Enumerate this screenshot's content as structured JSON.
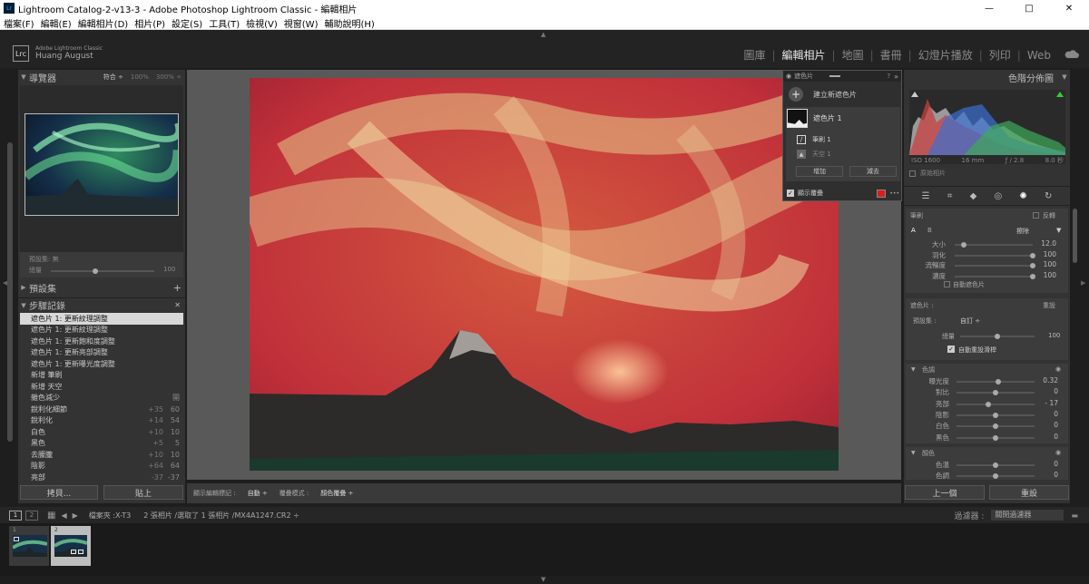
{
  "window": {
    "title": "Lightroom Catalog-2-v13-3 - Adobe Photoshop Lightroom Classic - 編輯相片",
    "minimize": "—",
    "maximize": "□",
    "close": "✕"
  },
  "menu": [
    "檔案(F)",
    "編輯(E)",
    "編輯相片(D)",
    "相片(P)",
    "設定(S)",
    "工具(T)",
    "檢視(V)",
    "視窗(W)",
    "輔助說明(H)"
  ],
  "identity": {
    "badge": "Lrc",
    "app": "Adobe Lightroom Classic",
    "user": "Huang August"
  },
  "modules": [
    {
      "label": "圖庫",
      "active": false
    },
    {
      "label": "編輯相片",
      "active": true
    },
    {
      "label": "地圖",
      "active": false
    },
    {
      "label": "書冊",
      "active": false
    },
    {
      "label": "幻燈片播放",
      "active": false
    },
    {
      "label": "列印",
      "active": false
    },
    {
      "label": "Web",
      "active": false
    }
  ],
  "navigator": {
    "title": "導覽器",
    "fit": "符合 ÷",
    "z1": "100%",
    "z2": "300% ÷"
  },
  "preset_amount": {
    "label": "預設集: 無",
    "amount_label": "總量",
    "amount_value": "100",
    "amount": 1.0
  },
  "presets": {
    "title": "預設集",
    "add": "+"
  },
  "history": {
    "title": "步驟記錄",
    "close": "✕",
    "items": [
      {
        "label": "遮色片 1: 更新紋理調整",
        "a": "",
        "b": "",
        "selected": true
      },
      {
        "label": "遮色片 1: 更新紋理調整",
        "a": "",
        "b": ""
      },
      {
        "label": "遮色片 1: 更新飽和度調整",
        "a": "",
        "b": ""
      },
      {
        "label": "遮色片 1: 更新亮部調整",
        "a": "",
        "b": ""
      },
      {
        "label": "遮色片 1: 更新曝光度調整",
        "a": "",
        "b": ""
      },
      {
        "label": "新增 筆刷",
        "a": "",
        "b": ""
      },
      {
        "label": "新增 天空",
        "a": "",
        "b": ""
      },
      {
        "label": "雜色減少",
        "a": "",
        "b": "開"
      },
      {
        "label": "銳利化細節",
        "a": "+35",
        "b": "60"
      },
      {
        "label": "銳利化",
        "a": "+14",
        "b": "54"
      },
      {
        "label": "白色",
        "a": "+10",
        "b": "10"
      },
      {
        "label": "黑色",
        "a": "+5",
        "b": "5"
      },
      {
        "label": "去朦朧",
        "a": "+10",
        "b": "10"
      },
      {
        "label": "陰影",
        "a": "+64",
        "b": "64"
      },
      {
        "label": "亮部",
        "a": "-37",
        "b": "-37"
      }
    ]
  },
  "left_buttons": {
    "copy": "拷貝...",
    "paste": "貼上"
  },
  "mask_panel": {
    "title": "遮色片",
    "help": "?",
    "expand": "»",
    "new_mask": "建立新遮色片",
    "mask_name": "遮色片 1",
    "component1": "筆刷 1",
    "component2": "天空 1",
    "add": "增加",
    "subtract": "減去",
    "overlay_label": "顯示覆疊",
    "more": "•••",
    "overlay_color": "#d81e1e"
  },
  "toolbar": {
    "show_label": "顯示編輯標記 :",
    "show_value": "自動 ÷",
    "overlay_label": "覆疊模式 :",
    "overlay_value": "顏色覆疊 ÷"
  },
  "histogram": {
    "title": "色階分佈圖",
    "iso": "ISO 1600",
    "focal": "16 mm",
    "aperture": "ƒ / 2.8",
    "shutter": "8.0 秒",
    "original": "原始相片"
  },
  "brush": {
    "title": "筆刷",
    "invert": "反轉",
    "a": "A",
    "b": "B",
    "erase": "擦除",
    "rows": [
      {
        "label": "大小",
        "value": "12.0",
        "pos": 0.12
      },
      {
        "label": "羽化",
        "value": "100",
        "pos": 1.0
      },
      {
        "label": "流暢度",
        "value": "100",
        "pos": 1.0
      },
      {
        "label": "濃度",
        "value": "100",
        "pos": 1.0
      }
    ],
    "automask": "自動遮色片"
  },
  "mask_settings": {
    "title": "遮色片 :",
    "reset": "重設",
    "preset_label": "預設集 :",
    "preset_value": "自訂 ÷",
    "amount_label": "總量",
    "amount_value": "100",
    "amount": 0.5,
    "auto_reset": "自動重設滑桿"
  },
  "tone": {
    "title": "色調",
    "rows": [
      {
        "label": "曝光度",
        "value": "0.32",
        "pos": 0.53
      },
      {
        "label": "對比",
        "value": "0",
        "pos": 0.5
      },
      {
        "label": "亮部",
        "value": "- 17",
        "pos": 0.41
      },
      {
        "label": "陰影",
        "value": "0",
        "pos": 0.5
      },
      {
        "label": "白色",
        "value": "0",
        "pos": 0.5
      },
      {
        "label": "黑色",
        "value": "0",
        "pos": 0.5
      }
    ]
  },
  "color": {
    "title": "顏色",
    "rows": [
      {
        "label": "色溫",
        "value": "0",
        "pos": 0.5
      },
      {
        "label": "色調",
        "value": "0",
        "pos": 0.5
      }
    ]
  },
  "right_buttons": {
    "prev": "上一個",
    "reset": "重設"
  },
  "filmstrip": {
    "view1": "1",
    "view2": "2",
    "folder": "檔案夾 :X-T3",
    "info": "2 張相片 /選取了 1 張相片 /MX4A1247.CR2 ÷",
    "filter_label": "過濾器 :",
    "filter_value": "關閉過濾器",
    "thumbs": [
      {
        "num": "1"
      },
      {
        "num": "2"
      }
    ]
  }
}
